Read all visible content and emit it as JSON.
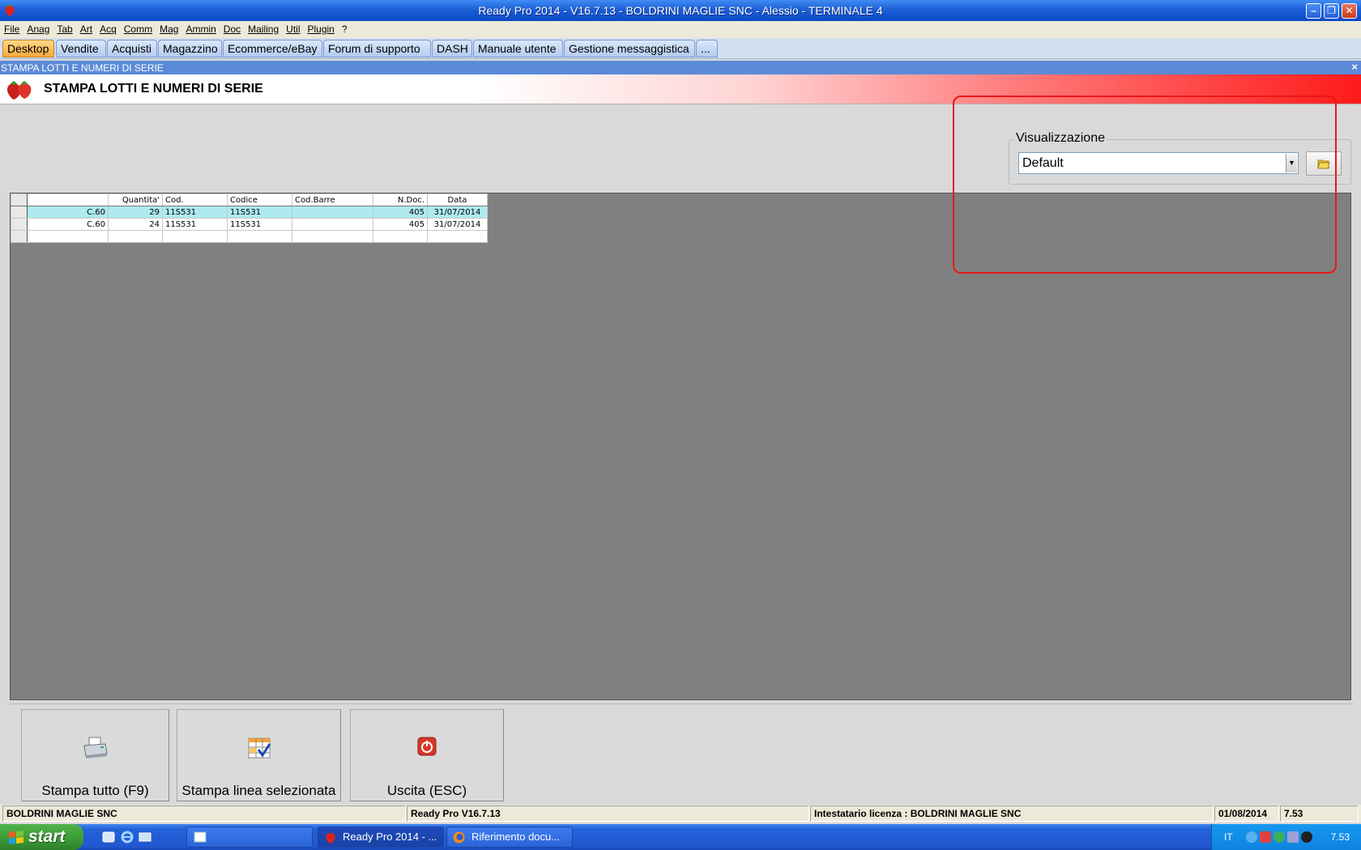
{
  "window": {
    "title": "Ready Pro 2014 - V16.7.13 - BOLDRINI MAGLIE SNC - Alessio - TERMINALE 4",
    "min_label": "–",
    "restore_label": "❐",
    "close_label": "✕"
  },
  "menu": [
    "File",
    "Anag",
    "Tab",
    "Art",
    "Acq",
    "Comm",
    "Mag",
    "Ammin",
    "Doc",
    "Mailing",
    "Util",
    "Plugin",
    "?"
  ],
  "tabs": [
    "Desktop",
    "Vendite",
    "Acquisti",
    "Magazzino",
    "Ecommerce/eBay",
    "Forum di supporto",
    "DASH",
    "Manuale utente",
    "Gestione messaggistica",
    "..."
  ],
  "active_tab": "Desktop",
  "inner": {
    "title": "STAMPA LOTTI E NUMERI DI SERIE",
    "close_label": "×",
    "header_title": "STAMPA LOTTI E NUMERI DI SERIE"
  },
  "visualizzazione": {
    "legend": "Visualizzazione",
    "selected": "Default",
    "arrow": "▼"
  },
  "grid": {
    "columns": [
      "",
      "Quantita'",
      "Cod.",
      "Codice",
      "Cod.Barre",
      "N.Doc.",
      "Data"
    ],
    "rows": [
      [
        "C.60",
        "29",
        "11S531",
        "11S531",
        "",
        "405",
        "31/07/2014"
      ],
      [
        "C.60",
        "24",
        "11S531",
        "11S531",
        "",
        "405",
        "31/07/2014"
      ],
      [
        "",
        "",
        "",
        "",
        "",
        "",
        ""
      ]
    ]
  },
  "buttons": {
    "print_all": "Stampa tutto (F9)",
    "print_selected": "Stampa linea selezionata",
    "exit": "Uscita (ESC)"
  },
  "status": {
    "company": "BOLDRINI MAGLIE SNC",
    "version": "Ready Pro V16.7.13",
    "license": "Intestatario licenza : BOLDRINI MAGLIE SNC",
    "date": "01/08/2014",
    "time": "7.53"
  },
  "taskbar": {
    "start": "start",
    "items": [
      "",
      "Ready Pro 2014 - ...",
      "Riferimento docu..."
    ],
    "lang": "IT",
    "clock": "7.53"
  },
  "colors": {
    "accent_red": "#ff1a1a",
    "selected_row": "#aeeaf0",
    "active_tab": "#f6a83c",
    "highlight_box": "#e81818"
  }
}
